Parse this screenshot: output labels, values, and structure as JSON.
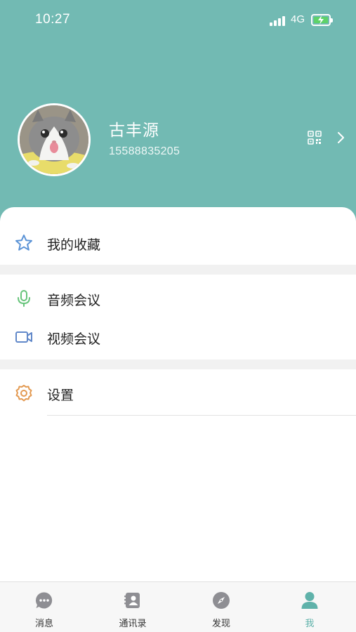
{
  "status_bar": {
    "time": "10:27",
    "network": "4G"
  },
  "profile": {
    "name": "古丰源",
    "phone": "15588835205"
  },
  "menu": {
    "favorites": "我的收藏",
    "audio_meeting": "音频会议",
    "video_meeting": "视频会议",
    "settings": "设置"
  },
  "tabs": [
    {
      "label": "消息",
      "icon": "message-icon"
    },
    {
      "label": "通讯录",
      "icon": "contacts-icon"
    },
    {
      "label": "发现",
      "icon": "compass-icon"
    },
    {
      "label": "我",
      "icon": "person-icon",
      "active": true
    }
  ],
  "colors": {
    "header_bg": "#72bab3",
    "accent": "#5fb2aa",
    "favorites_icon": "#5b93d6",
    "audio_icon": "#67c47b",
    "video_icon": "#6188c9",
    "settings_icon": "#e39a52",
    "battery_fill": "#5ed26a"
  }
}
